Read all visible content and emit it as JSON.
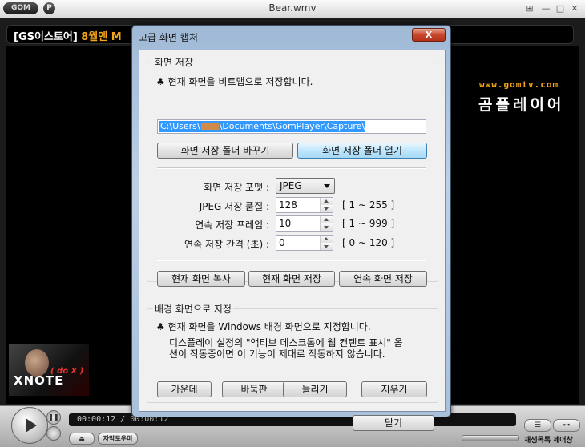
{
  "player": {
    "logo": "GOM",
    "pref_button": "P",
    "window_title": "Bear.wmv",
    "ticker": {
      "prefix": "[GS이스토어]",
      "highlight": "8월엔 M"
    },
    "brand_url": "www.gomtv.com",
    "brand_name": "곰플레이어",
    "thumbnail": {
      "dox": "( do X )",
      "xnote": "XNOTE"
    },
    "time_display": "00:00:12 / 00:00:12",
    "eject_label": "⏏",
    "subtitle_button": "자막토우미",
    "playlist_label": "재생목록",
    "control_label": "제어창"
  },
  "dialog": {
    "title": "고급 화면 캡처",
    "close_label": "X",
    "save_group": {
      "title": "화면 저장",
      "description": "♣ 현재 화면을 비트맵으로 저장합니다.",
      "path_prefix": "C:\\Users\\",
      "path_suffix": "\\Documents\\GomPlayer\\Capture\\",
      "change_folder_button": "화면 저장 폴더 바꾸기",
      "open_folder_button": "화면 저장 폴더 열기",
      "format_label": "화면 저장 포맷 :",
      "format_value": "JPEG",
      "quality_label": "JPEG 저장 품질 :",
      "quality_value": "128",
      "quality_range": "[ 1 ~ 255 ]",
      "frames_label": "연속 저장 프레임 :",
      "frames_value": "10",
      "frames_range": "[ 1 ~ 999 ]",
      "interval_label": "연속 저장 간격 (초) :",
      "interval_value": "0",
      "interval_range": "[ 0 ~ 120 ]",
      "copy_button": "현재 화면 복사",
      "save_button": "현재 화면 저장",
      "burst_button": "연속 화면 저장"
    },
    "wallpaper_group": {
      "title": "배경 화면으로 지정",
      "description": "♣ 현재 화면을 Windows 배경 화면으로 지정합니다.",
      "note_line1": "디스플레이 설정의 \"액티브 데스크톱에 웹 컨텐트 표시\" 옵",
      "note_line2": "션이 작동중이면 이 기능이 제대로 작동하지 않습니다.",
      "center_button": "가운데",
      "tile_button": "바둑판",
      "stretch_button": "늘리기",
      "clear_button": "지우기"
    },
    "close_button": "닫기"
  }
}
